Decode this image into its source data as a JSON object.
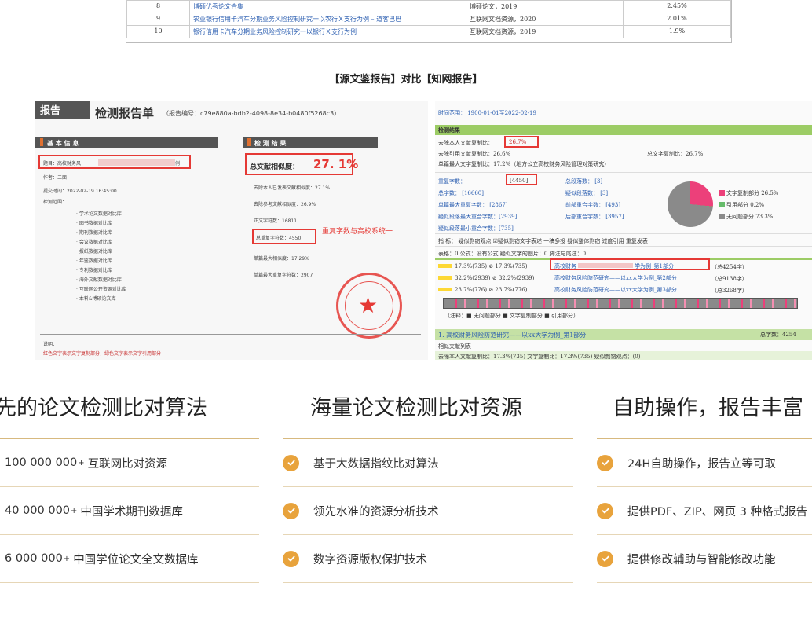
{
  "top_table": {
    "rows": [
      {
        "idx": "8",
        "title": "博硕优秀论文合集",
        "source": "博硕论文，2019",
        "pct": "2.45%"
      },
      {
        "idx": "9",
        "title": "农业银行信用卡汽车分期业务风险控制研究一以农行Ｘ支行为例 – 道客巴巴",
        "source": "互联网文档资源，2020",
        "pct": "2.01%"
      },
      {
        "idx": "10",
        "title": "银行信用卡汽车分期业务风险控制研究一以银行Ｘ支行为例",
        "source": "互联网文档资源，2019",
        "pct": "1.9%"
      }
    ]
  },
  "compare_title": "【源文鉴报告】对比【知网报告】",
  "left_report": {
    "corner": "报告",
    "title": "检测报告单",
    "report_no": "（报告编号：c79e880a-bdb2-4098-8e34-b0480f5268c3）",
    "basic_info_bar": "基 本 信 息",
    "result_bar": "检 测 结 果",
    "topic_label": "题目：高校财务风",
    "topic_tail": "例",
    "author": "作者：二面",
    "submit_time": "提交时间：2022-02-19  16:45:00",
    "scope_label": "检测范围：",
    "scope_items": [
      "· 学术论文数据对比库",
      "· 图书数据对比库",
      "· 期刊数据对比库",
      "· 会议数据对比库",
      "· 报纸数据对比库",
      "· 年鉴数据对比库",
      "· 专利数据对比库",
      "· 海外文献数据对比库",
      "· 互联网公开资源对比库",
      "· 本科&博硕论文库"
    ],
    "total_sim_label": "总文献相似度：",
    "total_sim_value": "27. 1%",
    "stat_lines": [
      "去除本人已发表文献相似度：27.1%",
      "去除参考文献相似度：26.9%",
      "正文字符数：16811",
      "总重复字符数：4550",
      "单篇最大相似度：17.29%",
      "单篇最大重复字符数：2907"
    ],
    "red_note": "重复字数与高校系统一",
    "footer_label": "说明：",
    "footer_note": "红色文字表示文字复制部分，绿色文字表示文字引用部分"
  },
  "right_report": {
    "time_range": "时间范围：  1900-01-01至2022-02-19",
    "check_result_bar": "检测结果",
    "rows_top": [
      "去除本人文献复制比：",
      "去除引用文献复制比：26.6%",
      "单篇最大文字复制比：17.2%（地方公立高校财务风险管理对策研究）"
    ],
    "self_ratio": "26.7%",
    "total_copy_ratio": "总文字复制比：26.7%",
    "dup_chars_label": "重复字数：",
    "dup_chars_value": "[4450]",
    "stats_left": [
      "总字数：        [16660]",
      "单篇最大重复字数：     [2867]",
      "疑似段落最大重合字数：[2939]",
      "疑似段落最小重合字数：[735]"
    ],
    "stats_mid": [
      "总段落数：      [3]",
      "疑似段落数：   [3]",
      "前部重合字数：  [493]",
      "后部重合字数：  [3957]"
    ],
    "legend": [
      {
        "label": "文字复制部分 26.5%",
        "color": "#ec407a"
      },
      {
        "label": "引用部分 0.2%",
        "color": "#66bb6a"
      },
      {
        "label": "无问题部分 73.3%",
        "color": "#8a8a8a"
      }
    ],
    "indicator_row": "指    标：  疑似剽窃观点  ☑疑似剽窃文字表述  一稿多投  疑似整体剽窃  过度引用  重复发表",
    "table_row": "表格：0    公式：没有公式        疑似文字的图片：0      脚注与尾注：0",
    "part_rows": [
      {
        "pct": "17.3%(735)",
        "pct2": "17.3%(735)",
        "title": "高校财务",
        "tail": "学为例_第1部分",
        "count": "（总4254字）"
      },
      {
        "pct": "32.2%(2939)",
        "pct2": "32.2%(2939)",
        "title": "高校财务风险防范研究——以xx大学为例_第2部分",
        "tail": "",
        "count": "（总9138字）"
      },
      {
        "pct": "23.7%(776)",
        "pct2": "23.7%(776)",
        "title": "高校财务风险防范研究——以xx大学为例_第3部分",
        "tail": "",
        "count": "（总3268字）"
      }
    ],
    "stripe_legend": "（注释：■ 无问题部分   ■ 文字复制部分   ■ 引用部分）",
    "section_title": "1.  高校财务风险防范研究——以xx大学为例_第1部分",
    "section_total": "总字数：4254",
    "similar_list": "相似文献列表",
    "bottom_row": "去除本人文献复制比：17.3%(735)      文字复制比：17.3%(735)       疑似剽窃观点：(0)"
  },
  "features": [
    {
      "heading": "领先的论文检测比对算法",
      "items": [
        {
          "num": "100 000 000",
          "sup": "+",
          "text": "互联网比对资源"
        },
        {
          "num": "40 000 000",
          "sup": "+",
          "text": "中国学术期刊数据库"
        },
        {
          "num": "6 000 000",
          "sup": "+",
          "text": "中国学位论文全文数据库"
        }
      ]
    },
    {
      "heading": "海量论文检测比对资源",
      "items": [
        {
          "text": "基于大数据指纹比对算法"
        },
        {
          "text": "领先水准的资源分析技术"
        },
        {
          "text": "数字资源版权保护技术"
        }
      ]
    },
    {
      "heading": "自助操作，报告丰富",
      "items": [
        {
          "text": "24H自助操作，报告立等可取"
        },
        {
          "text": "提供PDF、ZIP、网页 3 种格式报告"
        },
        {
          "text": "提供修改辅助与智能修改功能"
        }
      ]
    }
  ],
  "colors": {
    "accent": "#e8a33c",
    "rule": "#d7b97f",
    "red": "#e53935"
  }
}
